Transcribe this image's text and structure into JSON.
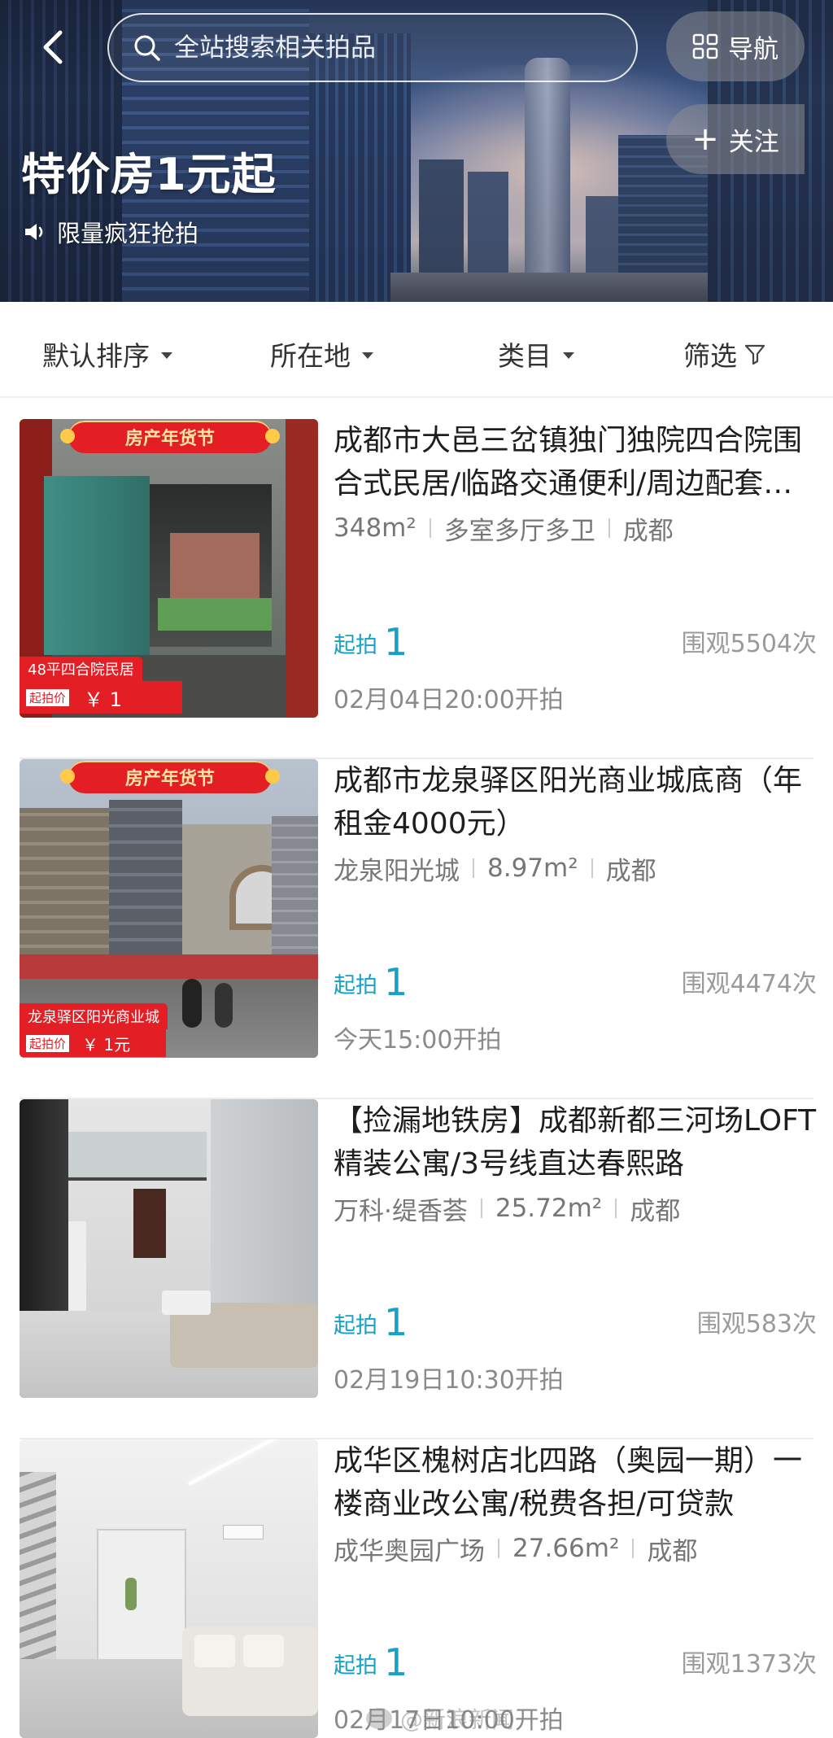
{
  "header": {
    "search_placeholder": "全站搜索相关拍品",
    "nav_label": "导航",
    "follow_label": "关注",
    "title": "特价房1元起",
    "subtitle": "限量疯狂抢拍"
  },
  "filters": [
    {
      "label": "默认排序"
    },
    {
      "label": "所在地"
    },
    {
      "label": "类目"
    },
    {
      "label": "筛选"
    }
  ],
  "listings": [
    {
      "title": "成都市大邑三岔镇独门独院四合院围合式民居/临路交通便利/周边配套齐全",
      "meta": [
        "348m²",
        "多室多厅多卫",
        "成都"
      ],
      "price_label": "起拍",
      "price": "1",
      "views": "围观5504次",
      "start_time": "02月04日20:00开拍",
      "thumb_badge": "房产年货节",
      "thumb_caption_1": "48平四合院民居",
      "thumb_caption_2_label": "起拍价",
      "thumb_caption_2_price": "￥ 1"
    },
    {
      "title": "成都市龙泉驿区阳光商业城底商（年租金4000元）",
      "meta": [
        "龙泉阳光城",
        "8.97m²",
        "成都"
      ],
      "price_label": "起拍",
      "price": "1",
      "views": "围观4474次",
      "start_time": "今天15:00开拍",
      "thumb_badge": "房产年货节",
      "thumb_caption_1": "龙泉驿区阳光商业城",
      "thumb_caption_2_label": "起拍价",
      "thumb_caption_2_price": "￥ 1元"
    },
    {
      "title": "【捡漏地铁房】成都新都三河场LOFT精装公寓/3号线直达春熙路",
      "meta": [
        "万科·缇香荟",
        "25.72m²",
        "成都"
      ],
      "price_label": "起拍",
      "price": "1",
      "views": "围观583次",
      "start_time": "02月19日10:30开拍"
    },
    {
      "title": "成华区槐树店北四路（奥园一期）一楼商业改公寓/税费各担/可贷款",
      "meta": [
        "成华奥园广场",
        "27.66m²",
        "成都"
      ],
      "price_label": "起拍",
      "price": "1",
      "views": "围观1373次",
      "start_time": "02月17日10:00开拍"
    }
  ],
  "watermark": "@新浪新闻",
  "colors": {
    "accent": "#14a3c7",
    "badge_red": "#e31e24",
    "text_main": "#1e1e1e",
    "text_muted": "#8a8a8a"
  },
  "icons": [
    "back-arrow-icon",
    "search-icon",
    "grid-icon",
    "plus-icon",
    "speaker-icon",
    "caret-down-icon",
    "filter-icon"
  ]
}
